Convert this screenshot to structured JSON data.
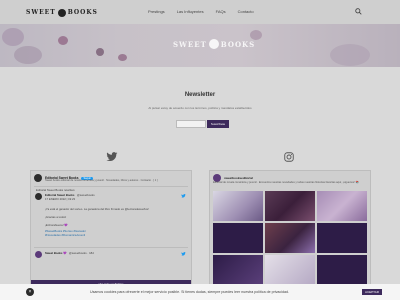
{
  "header": {
    "logo": {
      "left": "SWEET",
      "right": "BOOKS"
    },
    "nav": [
      "Prestings",
      "Las Influyentes",
      "FAQs",
      "Contacto"
    ],
    "search_icon": "search-icon"
  },
  "hero": {
    "logo": {
      "left": "SWEET",
      "right": "BOOKS"
    }
  },
  "newsletter": {
    "title": "Newsletter",
    "text": "Al pulsar estoy de acuerdo con los términos, política y mandatos establecidos",
    "input_placeholder": "",
    "button": "Suscríbete"
  },
  "twitter": {
    "icon": "twitter-icon",
    "account_name": "Editorial Sweet Books",
    "follow_label": "Seguir",
    "description": "Sweet books editorial de novela romántica y juvenil · Novedades, libros y autores · Contacto · [ 1 ]",
    "retweet_label": "Editorial Sweet Books retwitteó",
    "quoted_name": "Editorial Sweet Books",
    "quoted_handle": "@sweetbooks",
    "tweet_date": "17 ENERO 2022 | 19:23",
    "tweet_lines": [
      "¡Ya está el ganador del sorteo. La ganadora del libro firmado es @lectoradesueños!",
      "¡Gracias a todos!",
      "¡Enhorabuena! 💜"
    ],
    "tweet_links": [
      "#SweetBooks #Sorteo #Ganador",
      "#Novedades #RomanticaJuvenil"
    ],
    "footer_name": "Sweet Books 💜",
    "footer_handle": "@sweetbooks · 18d",
    "cta": "Ver más en Twitter"
  },
  "instagram": {
    "icon": "instagram-icon",
    "handle": "sweetbookseditorial",
    "description": "Editorial de novela romántica y juvenil · Encuentra nuestras novedades y todas nuestras historias favoritas aquí, ¡síguenos! 📚",
    "tiles": [
      {
        "text": ""
      },
      {
        "text": ""
      },
      {
        "text": ""
      },
      {
        "text": ""
      },
      {
        "text": ""
      },
      {
        "text": ""
      },
      {
        "text": ""
      },
      {
        "text": ""
      },
      {
        "text": ""
      }
    ]
  },
  "cookies": {
    "text": "Usamos cookies para ofrecerte el mejor servicio posible. Si tienes dudas, siempre puedes leer nuestra política de privacidad.",
    "accept": "ACEPTAR",
    "close": "×"
  }
}
